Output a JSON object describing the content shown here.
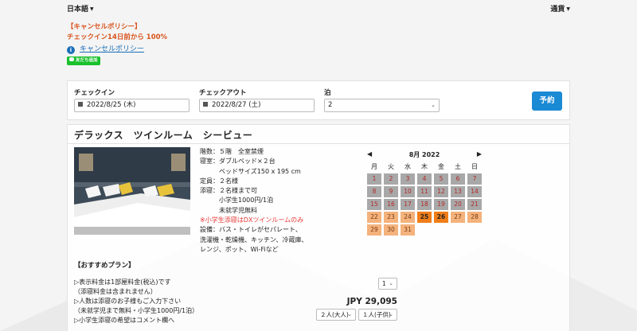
{
  "header": {
    "language": "日本語",
    "currency": "通貨"
  },
  "policy": {
    "title": "【キャンセルポリシー】",
    "rule": "チェックイン14日前から 100%",
    "link_label": "キャンセルポリシー",
    "line_badge": "友だち追加"
  },
  "search": {
    "checkin_label": "チェックイン",
    "checkin_value": "2022/8/25 (木)",
    "checkout_label": "チェックアウト",
    "checkout_value": "2022/8/27 (土)",
    "nights_label": "泊",
    "nights_value": "2",
    "book_label": "予約"
  },
  "room": {
    "title": "デラックス　ツインルーム　シービュー",
    "details": [
      "階数：５階　全室禁煙",
      "寝室：ダブルベッド×２台",
      "　　　ベッドサイズ150 x 195 cm",
      "定員：２名様",
      "添寝：２名様まで可",
      "　　　小学生1000円/1泊",
      "　　　未就学児無料",
      "※小学生添寝はDXツインルームのみ",
      "設備：バス・トイレがセパレート、",
      "洗濯機・乾燥機、キッチン、冷蔵庫、",
      "レンジ、ポット、Wi-Fiなど"
    ]
  },
  "calendar": {
    "month_label": "8月 2022",
    "weekdays": [
      "月",
      "火",
      "水",
      "木",
      "金",
      "土",
      "日"
    ],
    "weeks": [
      [
        "1",
        "2",
        "3",
        "4",
        "5",
        "6",
        "7"
      ],
      [
        "8",
        "9",
        "10",
        "11",
        "12",
        "13",
        "14"
      ],
      [
        "15",
        "16",
        "17",
        "18",
        "19",
        "20",
        "21"
      ],
      [
        "22",
        "23",
        "24",
        "25",
        "26",
        "27",
        "28"
      ],
      [
        "29",
        "30",
        "31",
        "",
        "",
        "",
        ""
      ]
    ],
    "colors": {
      "past": "#a8a8a8",
      "available": "#f4b27c",
      "selected": "#f07d1a"
    }
  },
  "plans": {
    "title": "【おすすめプラン】",
    "notes": [
      "▷表示料金は1部屋料金(税込)です",
      "（添寝料金は含まれません）",
      "▷人数は添寝のお子様もご入力下さい",
      "（未就学児まで無料・小学生1000円/1泊）",
      "▷小学生添寝の希望はコメント欄へ"
    ],
    "rooms_value": "1",
    "price": "JPY 29,095",
    "adults_value": "２人(大人)",
    "children_value": "１人(子供)"
  }
}
